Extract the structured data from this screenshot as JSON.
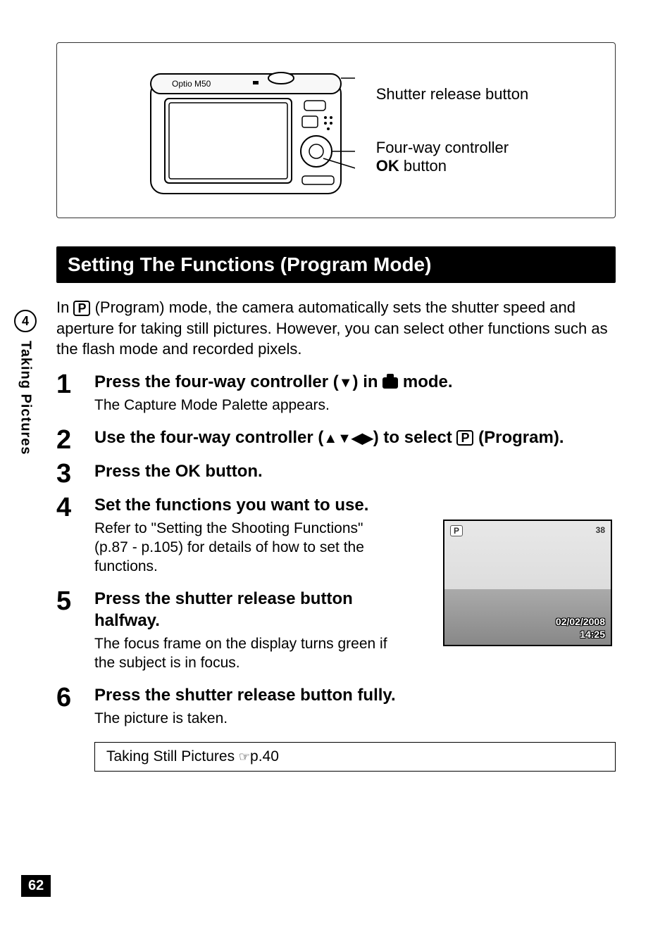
{
  "sideTab": {
    "chapter": "4",
    "label": "Taking Pictures"
  },
  "pageNumber": "62",
  "diagram": {
    "cameraModel": "Optio M50",
    "labels": {
      "shutter": "Shutter release button",
      "fourway": "Four-way controller",
      "okPrefix": "OK",
      "okSuffix": " button"
    }
  },
  "sectionHeader": "Setting The Functions (Program Mode)",
  "intro": {
    "prefix": "In ",
    "pIcon": "P",
    "rest": " (Program) mode, the camera automatically sets the shutter speed and aperture for taking still pictures. However, you can select other functions such as the flash mode and recorded pixels."
  },
  "steps": [
    {
      "num": "1",
      "titleParts": {
        "a": "Press the four-way controller (",
        "arrow": "▼",
        "b": ") in ",
        "c": " mode."
      },
      "desc": "The Capture Mode Palette appears."
    },
    {
      "num": "2",
      "titleParts": {
        "a": "Use the four-way controller (",
        "arrows": "▲▼◀▶",
        "b": ") to select ",
        "pIcon": "P",
        "c": " (Program)."
      }
    },
    {
      "num": "3",
      "titleParts": {
        "a": "Press the ",
        "ok": "OK",
        "b": " button."
      }
    },
    {
      "num": "4",
      "title": "Set the functions you want to use.",
      "desc": "Refer to \"Setting the Shooting Functions\" (p.87 - p.105) for details of how to set the functions."
    },
    {
      "num": "5",
      "title": "Press the shutter release button halfway.",
      "desc": "The focus frame on the display turns green if the subject is in focus."
    },
    {
      "num": "6",
      "title": "Press the shutter release button fully.",
      "desc": "The picture is taken."
    }
  ],
  "screenshot": {
    "pBadge": "P",
    "count": "38",
    "date": "02/02/2008",
    "time": "14:25"
  },
  "refBox": {
    "text": "Taking Still Pictures ",
    "hand": "☞",
    "page": "p.40"
  }
}
